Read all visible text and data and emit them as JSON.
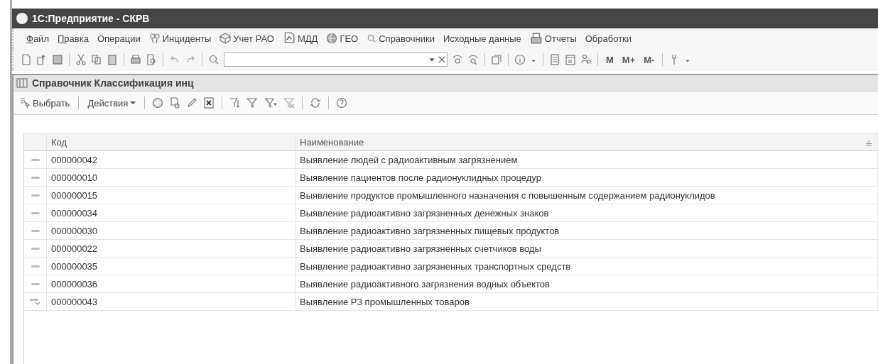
{
  "window": {
    "title": "1С:Предприятие - СКРВ"
  },
  "menu": [
    {
      "label": "Файл",
      "mnemonic": true
    },
    {
      "label": "Правка",
      "mnemonic": true
    },
    {
      "label": "Операции",
      "mnemonic": false
    },
    {
      "label": "Инциденты",
      "mnemonic": false
    },
    {
      "label": "Учет РАО",
      "mnemonic": false
    },
    {
      "label": "МДД",
      "mnemonic": false
    },
    {
      "label": "ГЕО",
      "mnemonic": false
    },
    {
      "label": "Справочники",
      "mnemonic": false
    },
    {
      "label": "Исходные данные",
      "mnemonic": false
    },
    {
      "label": "Отчеты",
      "mnemonic": false
    },
    {
      "label": "Обработки",
      "mnemonic": false
    }
  ],
  "toolbar": {
    "memory_buttons": [
      "M",
      "M+",
      "M-"
    ]
  },
  "form": {
    "title": "Справочник Классификация инц",
    "select_button": "Выбрать",
    "actions_button": "Действия"
  },
  "table": {
    "columns": [
      "Код",
      "Наименование"
    ],
    "rows": [
      {
        "kind": "plain",
        "code": "000000042",
        "name": "Выявление людей с радиоактивным загрязнением"
      },
      {
        "kind": "plain",
        "code": "000000010",
        "name": "Выявление пациентов после радионуклидных процедур"
      },
      {
        "kind": "plain",
        "code": "000000015",
        "name": "Выявление продуктов промышленного назначения с повышенным содержанием радионуклидов"
      },
      {
        "kind": "plain",
        "code": "000000034",
        "name": "Выявление радиоактивно загрязненных денежных знаков"
      },
      {
        "kind": "plain",
        "code": "000000030",
        "name": "Выявление радиоактивно загрязненных пищевых продуктов"
      },
      {
        "kind": "plain",
        "code": "000000022",
        "name": "Выявление радиоактивно загрязненных счетчиков воды"
      },
      {
        "kind": "plain",
        "code": "000000035",
        "name": "Выявление радиоактивно загрязненных транспортных средств"
      },
      {
        "kind": "plain",
        "code": "000000036",
        "name": "Выявление радиоактивного загрязнения водных объектов"
      },
      {
        "kind": "nested",
        "code": "000000043",
        "name": "Выявление РЗ промышленных товаров"
      }
    ]
  }
}
